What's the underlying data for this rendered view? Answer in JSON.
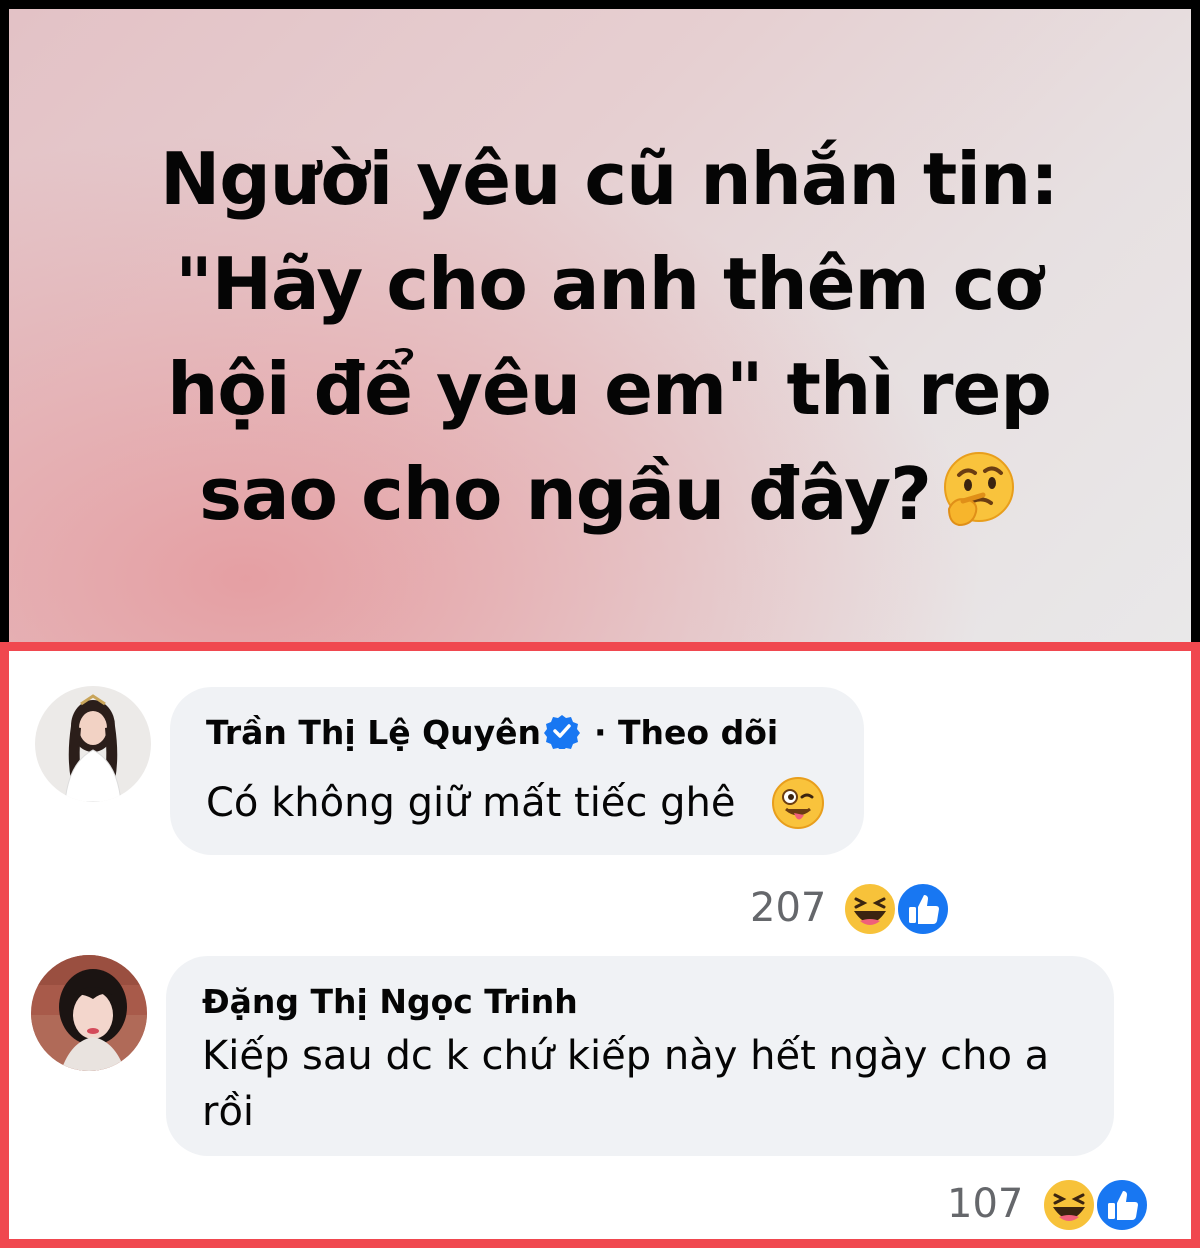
{
  "post": {
    "text_lines": [
      "Người yêu cũ nhắn tin:",
      "\"Hãy cho anh thêm cơ",
      "hội để yêu em\" thì rep",
      "sao cho ngầu đây?"
    ],
    "emoji": "thinking-face"
  },
  "comments": [
    {
      "author": "Trần Thị Lệ Quyên",
      "verified": true,
      "follow_label": "· Theo dõi",
      "text": "Có không giữ mất tiếc ghê",
      "emoji": "winking-face-with-tongue",
      "reaction_count": "207",
      "reactions": [
        "haha-icon",
        "like-icon"
      ]
    },
    {
      "author": "Đặng Thị Ngọc Trinh",
      "verified": false,
      "text": "Kiếp sau dc k chứ kiếp này hết ngày cho a rồi",
      "reaction_count": "107",
      "reactions": [
        "haha-icon",
        "like-icon"
      ]
    }
  ],
  "colors": {
    "frame_border": "#f0484f",
    "bubble_bg": "#f0f2f5",
    "verified_blue": "#1877f2",
    "count_gray": "#65676b"
  }
}
